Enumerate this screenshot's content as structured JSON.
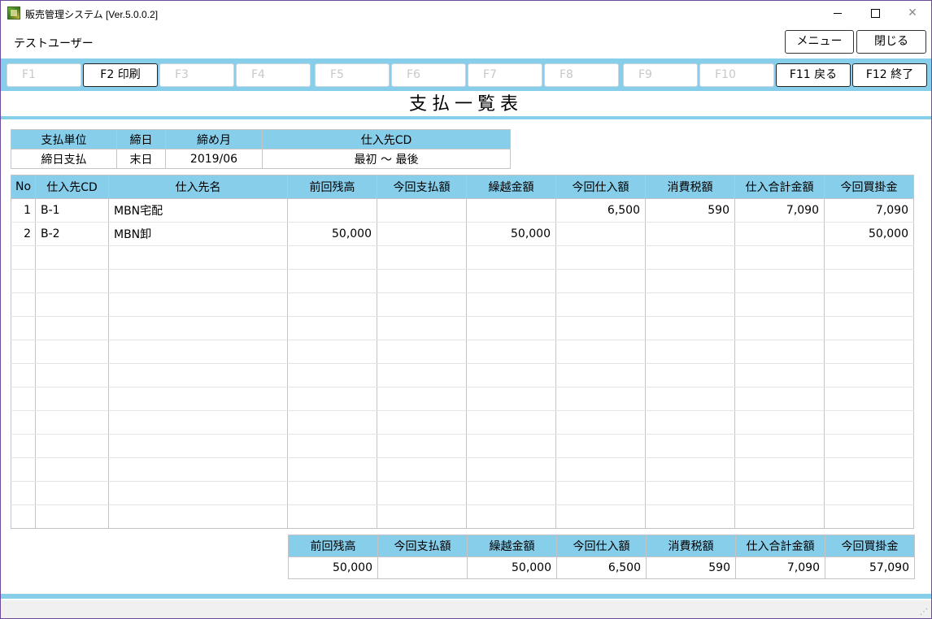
{
  "window": {
    "title": "販売管理システム [Ver.5.0.0.2]"
  },
  "user": {
    "name": "テストユーザー"
  },
  "top_buttons": {
    "menu": "メニュー",
    "close": "閉じる"
  },
  "fkeys": [
    {
      "label": "F1",
      "enabled": false
    },
    {
      "label": "F2 印刷",
      "enabled": true
    },
    {
      "label": "F3",
      "enabled": false
    },
    {
      "label": "F4",
      "enabled": false
    },
    {
      "label": "F5",
      "enabled": false
    },
    {
      "label": "F6",
      "enabled": false
    },
    {
      "label": "F7",
      "enabled": false
    },
    {
      "label": "F8",
      "enabled": false
    },
    {
      "label": "F9",
      "enabled": false
    },
    {
      "label": "F10",
      "enabled": false
    },
    {
      "label": "F11 戻る",
      "enabled": true
    },
    {
      "label": "F12 終了",
      "enabled": true
    }
  ],
  "screen_title": "支払一覧表",
  "criteria": {
    "headers": {
      "unit": "支払単位",
      "close_day": "締日",
      "close_month": "締め月",
      "supplier_cd": "仕入先CD"
    },
    "values": {
      "unit": "締日支払",
      "close_day": "末日",
      "close_month": "2019/06",
      "supplier_cd": "最初 〜 最後"
    }
  },
  "grid": {
    "headers": {
      "no": "No",
      "code": "仕入先CD",
      "name": "仕入先名",
      "prev_balance": "前回残高",
      "payment": "今回支払額",
      "carryover": "繰越金額",
      "purchase": "今回仕入額",
      "tax": "消費税額",
      "purchase_total": "仕入合計金額",
      "payable": "今回買掛金"
    },
    "rows": [
      {
        "no": "1",
        "code": "B-1",
        "name": "MBN宅配",
        "prev_balance": "",
        "payment": "",
        "carryover": "",
        "purchase": "6,500",
        "tax": "590",
        "purchase_total": "7,090",
        "payable": "7,090"
      },
      {
        "no": "2",
        "code": "B-2",
        "name": "MBN卸",
        "prev_balance": "50,000",
        "payment": "",
        "carryover": "50,000",
        "purchase": "",
        "tax": "",
        "purchase_total": "",
        "payable": "50,000"
      }
    ]
  },
  "totals": {
    "headers": {
      "prev_balance": "前回残高",
      "payment": "今回支払額",
      "carryover": "繰越金額",
      "purchase": "今回仕入額",
      "tax": "消費税額",
      "purchase_total": "仕入合計金額",
      "payable": "今回買掛金"
    },
    "values": {
      "prev_balance": "50,000",
      "payment": "",
      "carryover": "50,000",
      "purchase": "6,500",
      "tax": "590",
      "purchase_total": "7,090",
      "payable": "57,090"
    }
  },
  "colors": {
    "accent": "#87ceeb",
    "frame": "#6b4a9c",
    "disabled_text": "#c8c8c8"
  }
}
